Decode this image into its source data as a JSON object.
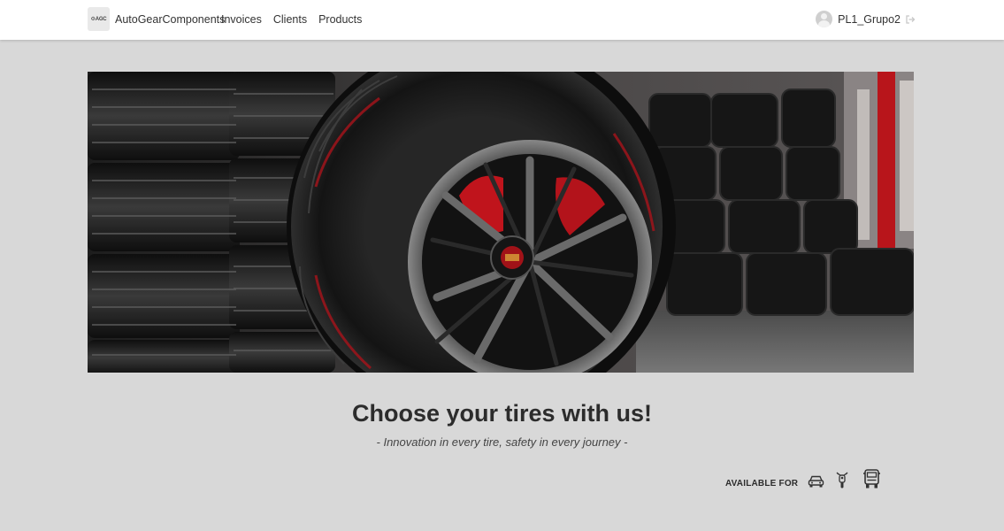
{
  "navbar": {
    "logo_text": "⚙AGC",
    "brand": "AutoGearComponents",
    "links": [
      {
        "label": "Invoices"
      },
      {
        "label": "Clients"
      },
      {
        "label": "Products"
      }
    ],
    "user": {
      "name": "PL1_Grupo2"
    }
  },
  "hero": {
    "image": "tire-and-alloy-wheel-in-tire-warehouse",
    "colors": {
      "brake_caliper": "#c0141c",
      "wheel": "#1c1c1c"
    }
  },
  "main": {
    "headline": "Choose your tires with us!",
    "tagline": "- Innovation in every tire, safety in every journey -",
    "available_label": "AVAILABLE FOR",
    "vehicle_icons": [
      "car-icon",
      "motorcycle-icon",
      "truck-icon"
    ]
  },
  "theme": {
    "background": "#d8d8d8",
    "navbar": "#ffffff",
    "text": "#2c2c2c"
  }
}
